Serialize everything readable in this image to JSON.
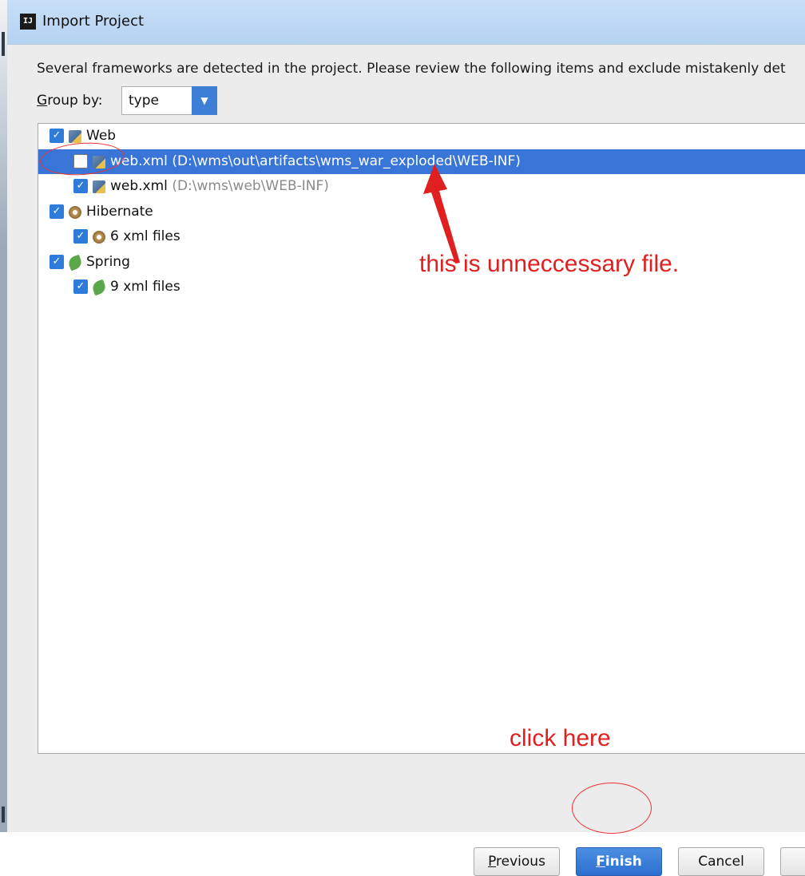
{
  "window": {
    "title": "Import Project",
    "icon": "intellij-icon"
  },
  "dialog": {
    "description": "Several frameworks are detected in the project. Please review the following items and exclude mistakenly det",
    "group_by": {
      "label_prefix": "G",
      "label_rest": "roup by:",
      "value": "type"
    }
  },
  "tree": {
    "items": [
      {
        "label": "Web",
        "path": "",
        "checked": true,
        "level": 0,
        "icon": "web-icon",
        "selected": false
      },
      {
        "label": "web.xml",
        "path": "(D:\\wms\\out\\artifacts\\wms_war_exploded\\WEB-INF)",
        "checked": false,
        "level": 1,
        "icon": "web-xml-icon",
        "selected": true
      },
      {
        "label": "web.xml",
        "path": "(D:\\wms\\web\\WEB-INF)",
        "checked": true,
        "level": 1,
        "icon": "web-xml-icon",
        "selected": false
      },
      {
        "label": "Hibernate",
        "path": "",
        "checked": true,
        "level": 0,
        "icon": "hibernate-icon",
        "selected": false
      },
      {
        "label": "6 xml files",
        "path": "",
        "checked": true,
        "level": 1,
        "icon": "hibernate-icon",
        "selected": false
      },
      {
        "label": "Spring",
        "path": "",
        "checked": true,
        "level": 0,
        "icon": "spring-icon",
        "selected": false
      },
      {
        "label": "9 xml files",
        "path": "",
        "checked": true,
        "level": 1,
        "icon": "spring-icon",
        "selected": false
      }
    ]
  },
  "annotations": {
    "unnecessary": "this is unneccessary file.",
    "click_here": "click here",
    "color": "#e02020"
  },
  "buttons": {
    "previous": {
      "mnemonic": "P",
      "rest": "revious"
    },
    "finish": {
      "mnemonic": "F",
      "rest": "inish"
    },
    "cancel": "Cancel"
  },
  "colors": {
    "accent": "#3875d7",
    "checkbox": "#2f7bd9",
    "titlebar": "#c7dff7"
  }
}
